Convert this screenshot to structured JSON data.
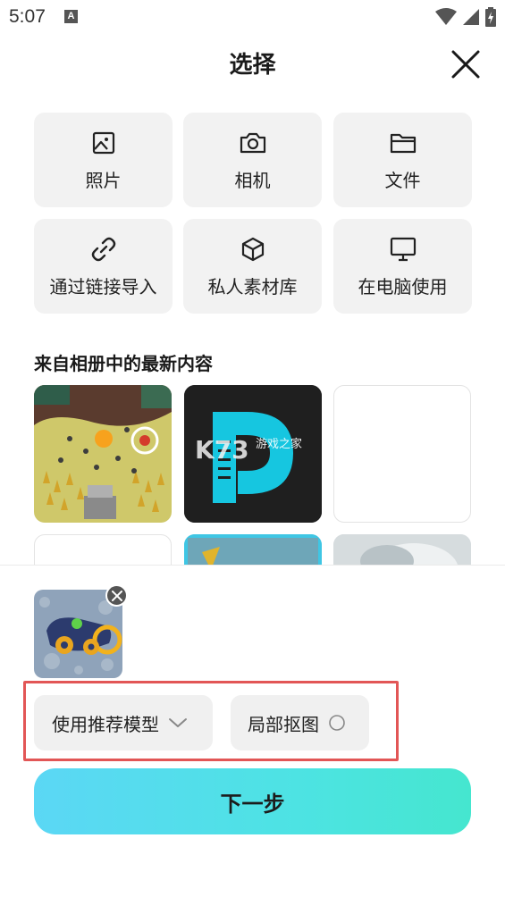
{
  "status_bar": {
    "time": "5:07",
    "notification_badge": "A"
  },
  "header": {
    "title": "选择"
  },
  "sources": [
    {
      "label": "照片",
      "icon": "image-icon"
    },
    {
      "label": "相机",
      "icon": "camera-icon"
    },
    {
      "label": "文件",
      "icon": "folder-icon"
    },
    {
      "label": "通过链接导入",
      "icon": "link-icon"
    },
    {
      "label": "私人素材库",
      "icon": "cube-icon"
    },
    {
      "label": "在电脑使用",
      "icon": "monitor-icon"
    }
  ],
  "recent": {
    "title": "来自相册中的最新内容",
    "watermark": "游戏之家"
  },
  "options": {
    "model_label": "使用推荐模型",
    "cutout_label": "局部抠图"
  },
  "actions": {
    "next_label": "下一步"
  },
  "colors": {
    "highlight": "#e25656",
    "button_gradient_start": "#5bd7f5",
    "button_gradient_end": "#45e6cf"
  }
}
